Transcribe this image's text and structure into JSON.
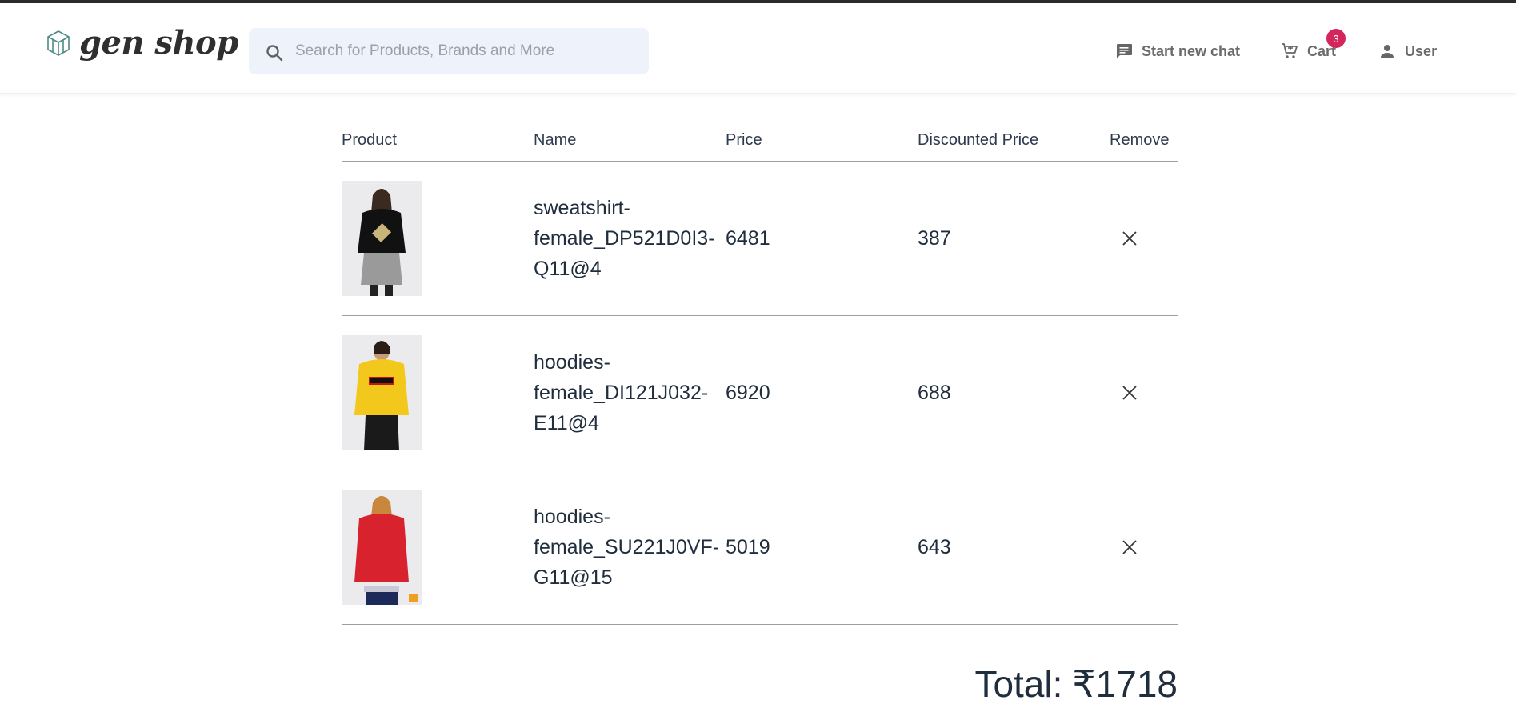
{
  "header": {
    "brand": "gen shop",
    "search_placeholder": "Search for Products, Brands and More",
    "start_chat_label": "Start new chat",
    "cart_label": "Cart",
    "cart_count": "3",
    "user_label": "User"
  },
  "table": {
    "headers": {
      "product": "Product",
      "name": "Name",
      "price": "Price",
      "discounted_price": "Discounted Price",
      "remove": "Remove"
    },
    "rows": [
      {
        "name": "sweatshirt-female_DP521D0I3-Q11@4",
        "name_lines": [
          "sweatshirt-",
          "female_DP521D0I3-",
          "Q11@4"
        ],
        "price": "6481",
        "discounted_price": "387",
        "image_colors": {
          "top": "#111111",
          "bottom": "#9a9a9a"
        }
      },
      {
        "name": "hoodies-female_DI121J032-E11@4",
        "name_lines": [
          "hoodies-",
          "female_DI121J032-",
          "E11@4"
        ],
        "price": "6920",
        "discounted_price": "688",
        "image_colors": {
          "top": "#f2c81c",
          "bottom": "#1a1a1a"
        }
      },
      {
        "name": "hoodies-female_SU221J0VF-G11@15",
        "name_lines": [
          "hoodies-",
          "female_SU221J0VF-",
          "G11@15"
        ],
        "price": "5019",
        "discounted_price": "643",
        "image_colors": {
          "top": "#d8232e",
          "bottom": "#1c2a5a"
        }
      }
    ]
  },
  "total": {
    "label": "Total:",
    "value": "₹1718"
  },
  "icons": {
    "logo": "hexagon-logo-icon",
    "search": "search-icon",
    "chat": "chat-icon",
    "cart": "cart-icon",
    "user": "user-icon",
    "remove": "close-icon"
  },
  "colors": {
    "badge": "#d3265c",
    "search_bg": "#eef2fb",
    "text_dark": "#1f2d3d",
    "nav_text": "#6b6b6b"
  }
}
